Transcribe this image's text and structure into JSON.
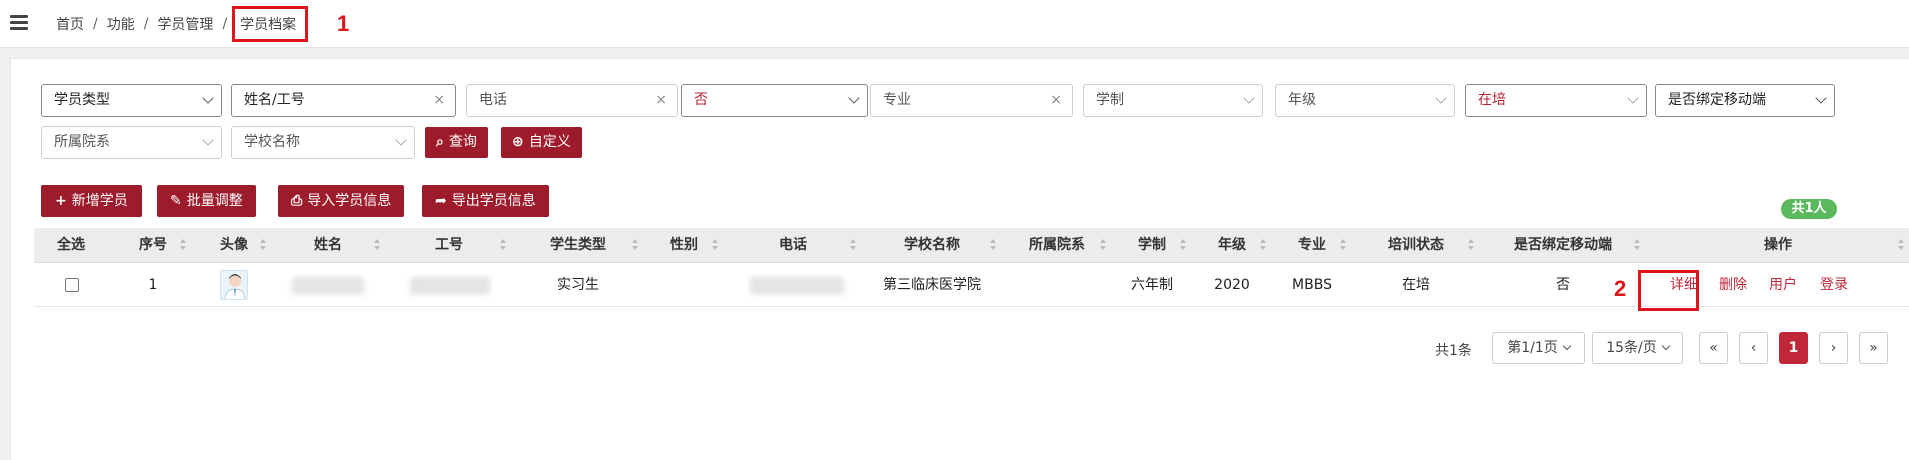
{
  "breadcrumb": {
    "items": [
      "首页",
      "功能",
      "学员管理",
      "学员档案"
    ],
    "separator": "/"
  },
  "annotations": {
    "first": "1",
    "second": "2"
  },
  "filters": {
    "student_type": "学员类型",
    "name_placeholder": "姓名/工号",
    "phone_placeholder": "电话",
    "yes_no": "否",
    "major_placeholder": "专业",
    "education_system": "学制",
    "grade": "年级",
    "training_status": "在培",
    "bind_mobile": "是否绑定移动端",
    "department": "所属院系",
    "school_name": "学校名称",
    "clear_icon": "×",
    "query_button": "查询",
    "custom_button": "自定义"
  },
  "toolbar": {
    "add_student": "新增学员",
    "batch_adjust": "批量调整",
    "import_students": "导入学员信息",
    "export_students": "导出学员信息",
    "count_badge": "共1人"
  },
  "table": {
    "headers": {
      "select_all": "全选",
      "index": "序号",
      "avatar": "头像",
      "name": "姓名",
      "employee_no": "工号",
      "student_type": "学生类型",
      "gender": "性别",
      "phone": "电话",
      "school_name": "学校名称",
      "department": "所属院系",
      "education_system": "学制",
      "grade": "年级",
      "major": "专业",
      "training_status": "培训状态",
      "bind_mobile": "是否绑定移动端",
      "operations": "操作"
    },
    "rows": [
      {
        "index": "1",
        "student_type": "实习生",
        "school_name": "第三临床医学院",
        "education_system": "六年制",
        "grade": "2020",
        "major": "MBBS",
        "training_status": "在培",
        "bind_mobile": "否",
        "actions": {
          "detail": "详细",
          "delete": "删除",
          "user": "用户",
          "login": "登录"
        }
      }
    ]
  },
  "pagination": {
    "total": "共1条",
    "page_select": "第1/1页",
    "page_size": "15条/页",
    "first": "«",
    "prev": "‹",
    "current": "1",
    "next": "›",
    "last": "»"
  },
  "colors": {
    "accent": "#9e1b2c",
    "link": "#c0283a",
    "highlight": "#e0141b",
    "badge": "#5cb85c"
  }
}
